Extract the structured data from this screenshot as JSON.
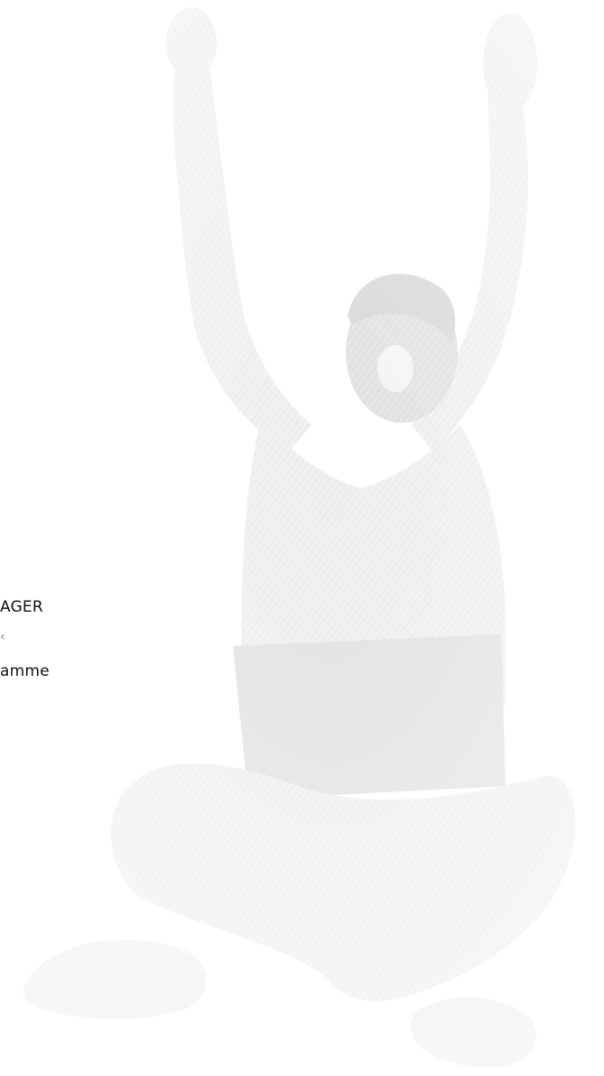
{
  "hero": {
    "image_subject": "celebrating-person-with-laptop-icon",
    "accent_color": "#e2e2e2",
    "line_1": "AGER",
    "line_2": "‹",
    "line_3": "amme"
  }
}
